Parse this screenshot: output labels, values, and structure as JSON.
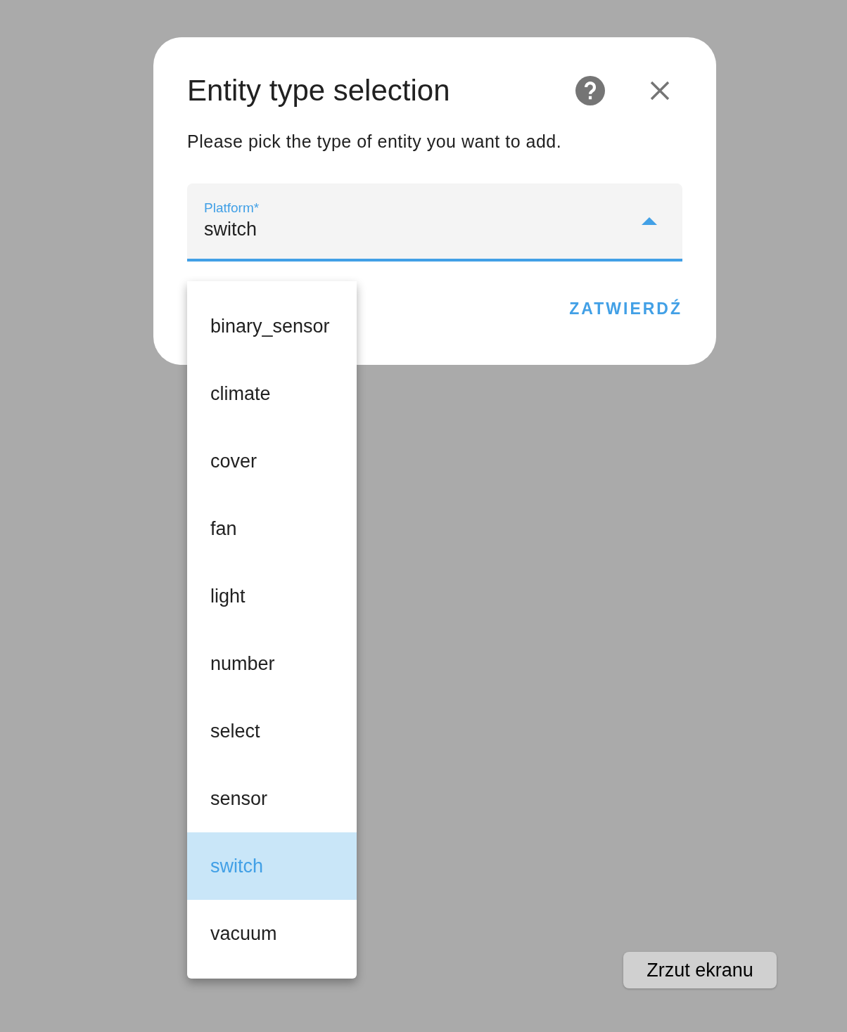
{
  "dialog": {
    "title": "Entity type selection",
    "description": "Please pick the type of entity you want to add.",
    "field": {
      "label": "Platform*",
      "value": "switch",
      "expanded": true
    },
    "confirm_button": "ZATWIERDŹ"
  },
  "menu": {
    "items": [
      {
        "label": "binary_sensor",
        "selected": false
      },
      {
        "label": "climate",
        "selected": false
      },
      {
        "label": "cover",
        "selected": false
      },
      {
        "label": "fan",
        "selected": false
      },
      {
        "label": "light",
        "selected": false
      },
      {
        "label": "number",
        "selected": false
      },
      {
        "label": "select",
        "selected": false
      },
      {
        "label": "sensor",
        "selected": false
      },
      {
        "label": "switch",
        "selected": true
      },
      {
        "label": "vacuum",
        "selected": false
      }
    ]
  },
  "tooltip": {
    "text": "Zrzut ekranu"
  }
}
